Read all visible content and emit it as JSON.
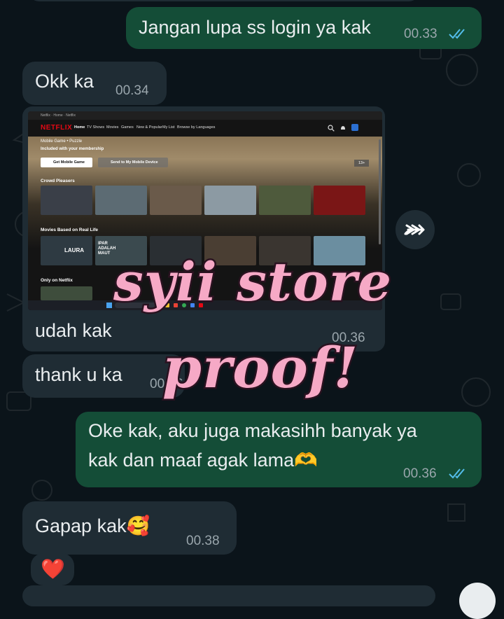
{
  "chat": {
    "messages": [
      {
        "id": "m1",
        "direction": "out",
        "text": "Jangan lupa ss login ya kak",
        "time": "00.33",
        "read": true
      },
      {
        "id": "m2",
        "direction": "in",
        "text": "Okk ka",
        "time": "00.34"
      },
      {
        "id": "m3",
        "direction": "in",
        "type": "image",
        "caption": "udah kak",
        "time": "00.36"
      },
      {
        "id": "m4",
        "direction": "in",
        "text": "thank u ka",
        "time": "00.36"
      },
      {
        "id": "m5",
        "direction": "out",
        "text_line1": "Oke kak, aku juga makasihh banyak ya",
        "text_line2": "kak dan maaf agak lama🫶",
        "time": "00.36",
        "read": true
      },
      {
        "id": "m6",
        "direction": "in",
        "text": "Gapap kak🥰",
        "time": "00.38"
      },
      {
        "id": "m7",
        "direction": "in",
        "text": "❤️"
      }
    ]
  },
  "screenshot": {
    "titlebar": "Netflix · Home · Netflix",
    "logo": "NETFLIX",
    "nav": [
      "Home",
      "TV Shows",
      "Movies",
      "Games",
      "New & Popular",
      "My List",
      "Browse by Languages"
    ],
    "hero_line1": "Mobile Game • Puzzle",
    "hero_line2": "Included with your membership",
    "btn_get": "Get Mobile Game",
    "btn_send": "Send to My Mobile Device",
    "rating": "13+",
    "rows": [
      "Crowd Pleasers",
      "Movies Based on Real Life",
      "Only on Netflix"
    ],
    "tile_titles": [
      "LAURA",
      "IPAR ADALAH MAUT"
    ]
  },
  "overlay": {
    "line1": "syii store",
    "line2": "proof!"
  },
  "colors": {
    "background": "#0b141a",
    "outgoing": "#144d37",
    "incoming": "#1f2c34",
    "read_ticks": "#53bdeb",
    "watermark_fill": "#f6a9c6"
  },
  "icons": [
    "read-receipt-icon",
    "forward-icon",
    "search-icon",
    "bell-icon"
  ]
}
